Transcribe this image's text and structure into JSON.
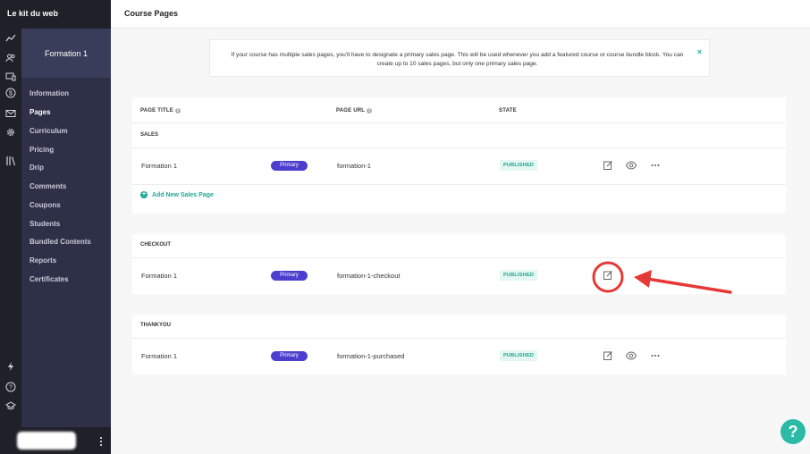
{
  "app": {
    "brand": "Le kit du web",
    "page_title": "Course Pages"
  },
  "rail_icons": [
    "analytics-icon",
    "users-icon",
    "devices-icon",
    "dollar-icon",
    "mail-icon",
    "settings-icon",
    "library-icon",
    "bolt-icon",
    "help-circle-icon",
    "graduation-cap-icon"
  ],
  "course": {
    "name": "Formation 1",
    "nav": [
      "Information",
      "Pages",
      "Curriculum",
      "Pricing",
      "Drip",
      "Comments",
      "Coupons",
      "Students",
      "Bundled Contents",
      "Reports",
      "Certificates"
    ],
    "active": "Pages"
  },
  "notice": {
    "text": "If your course has multiple sales pages, you'll have to designate a primary sales page. This will be used whenever you add a featured course or course bundle block. You can create up to 10 sales pages, but only one primary sales page.",
    "close": "×"
  },
  "table": {
    "headers": {
      "title": "PAGE TITLE",
      "url": "PAGE URL",
      "state": "STATE"
    },
    "sections": [
      {
        "label": "SALES",
        "rows": [
          {
            "name": "Formation 1",
            "badge": "Primary",
            "url": "formation-1",
            "state": "PUBLISHED"
          }
        ],
        "add_link": "Add New Sales Page"
      },
      {
        "label": "CHECKOUT",
        "rows": [
          {
            "name": "Formation 1",
            "badge": "Primary",
            "url": "formation-1-checkout",
            "state": "PUBLISHED"
          }
        ]
      },
      {
        "label": "THANKYOU",
        "rows": [
          {
            "name": "Formation 1",
            "badge": "Primary",
            "url": "formation-1-purchased",
            "state": "PUBLISHED"
          }
        ]
      }
    ]
  },
  "help_button": "?",
  "colors": {
    "accent": "#20b4a5",
    "primary_badge": "#4c3fcf",
    "annotation": "#e53935",
    "sidebar_dark": "#1f2028",
    "sidebar": "#2e3048"
  }
}
